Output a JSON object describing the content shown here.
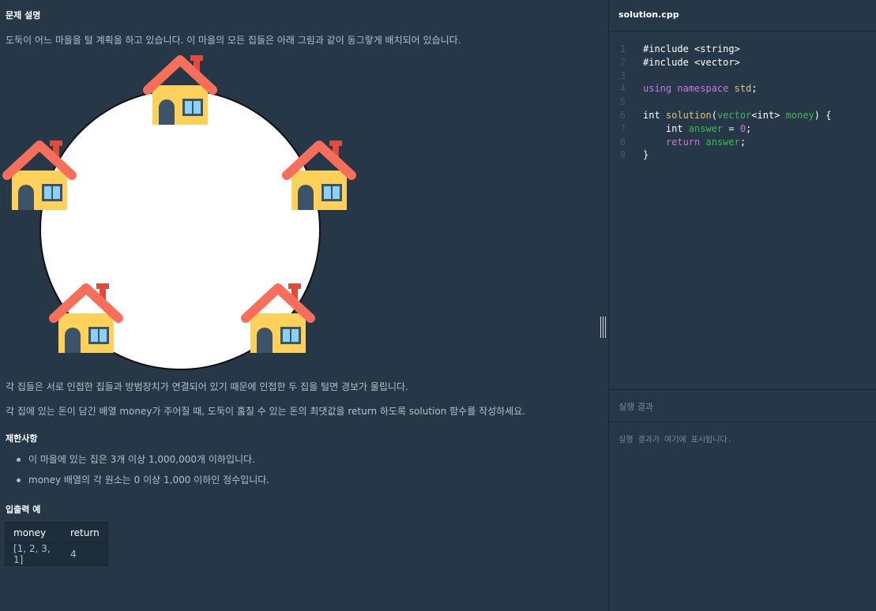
{
  "problem": {
    "title": "문제 설명",
    "intro": "도둑이 어느 마을을 털 계획을 하고 있습니다. 이 마을의 모든 집들은 아래 그림과 같이 동그랗게 배치되어 있습니다.",
    "desc1": "각 집들은 서로 인접한 집들과 방범장치가 연결되어 있기 때문에 인접한 두 집을 털면 경보가 울립니다.",
    "desc2": "각 집에 있는 돈이 담긴 배열 money가 주어질 때, 도둑이 훔칠 수 있는 돈의 최댓값을 return 하도록 solution 함수를 작성하세요.",
    "constraints_title": "제한사항",
    "constraints": [
      "이 마을에 있는 집은 3개 이상 1,000,000개 이하입니다.",
      "money 배열의 각 원소는 0 이상 1,000 이하인 정수입니다."
    ],
    "io_title": "입출력 예",
    "io_table": {
      "headers": [
        "money",
        "return"
      ],
      "rows": [
        [
          "[1, 2, 3, 1]",
          "4"
        ]
      ]
    },
    "illustration": {
      "houses": 5,
      "icon": "house-icon"
    }
  },
  "editor": {
    "filename": "solution.cpp",
    "line_numbers": [
      "1",
      "2",
      "3",
      "4",
      "5",
      "6",
      "7",
      "8",
      "9"
    ]
  },
  "result": {
    "title": "실행 결과",
    "placeholder": "실행 결과가 여기에 표시됩니다."
  },
  "colors": {
    "background": "#263747",
    "keyword": "#c678dd",
    "function": "#e5c07b",
    "identifier": "#3fb950"
  }
}
